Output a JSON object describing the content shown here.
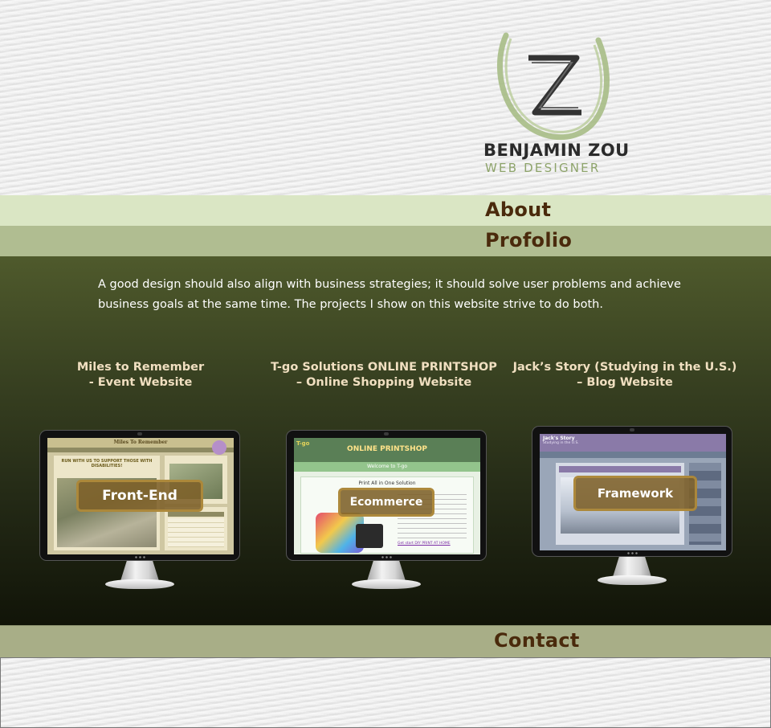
{
  "header": {
    "logo_name": "BENJAMIN ZOU",
    "logo_role": "WEB DESIGNER",
    "logo_icon": "z-monogram-icon"
  },
  "nav": {
    "about": "About",
    "portfolio": "Profolio",
    "contact": "Contact"
  },
  "intro": {
    "text": "A good design should also align with business strategies; it should  solve user problems and achieve business goals at the same time. The projects I show on this website strive to do both."
  },
  "projects": [
    {
      "title_line1": "Miles to Remember",
      "title_line2": "- Event Website",
      "tag": "Front-End",
      "screen_title": "Miles To Remember",
      "screen_headline": "RUN WITH US TO SUPPORT THOSE WITH DISABILITIES!"
    },
    {
      "title_line1": "T-go Solutions ONLINE PRINTSHOP",
      "title_line2": "– Online Shopping Website",
      "tag": "Ecommerce",
      "screen_title": "ONLINE PRINTSHOP",
      "screen_welcome": "Welcome to T-go",
      "screen_sub": "Print All in One Solution",
      "screen_link": "Get start DIY PRINT AT HOME"
    },
    {
      "title_line1": "Jack’s Story (Studying in the U.S.)",
      "title_line2": "– Blog Website",
      "tag": "Framework",
      "screen_title": "Jack's Story",
      "screen_sub": "Studying in the U.S."
    }
  ],
  "colors": {
    "nav_text": "#4a2a0c",
    "about_bg": "#dae6c4",
    "portfolio_bg": "#b0bd91",
    "contact_bg": "#a8ae87",
    "title_text": "#f0dfc0"
  }
}
